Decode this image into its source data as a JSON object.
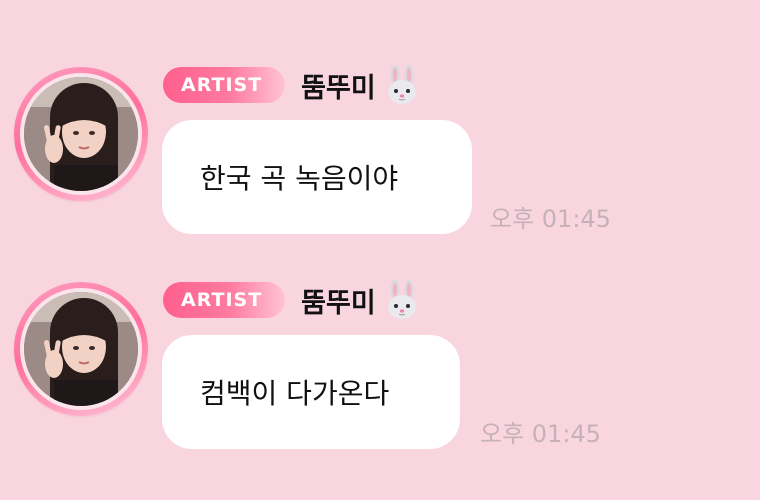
{
  "messages": [
    {
      "badge": "ARTIST",
      "sender": "뚬뚜미",
      "sender_emoji_icon": "rabbit-face-icon",
      "text": "한국 곡 녹음이야",
      "time": "오후 01:45"
    },
    {
      "badge": "ARTIST",
      "sender": "뚬뚜미",
      "sender_emoji_icon": "rabbit-face-icon",
      "text": "컴백이 다가온다",
      "time": "오후 01:45"
    }
  ],
  "colors": {
    "background": "#f9d6df",
    "badge_start": "#ff5f8e",
    "badge_end": "#ffc3d5",
    "bubble": "#ffffff",
    "timestamp": "#c7b1b8"
  }
}
